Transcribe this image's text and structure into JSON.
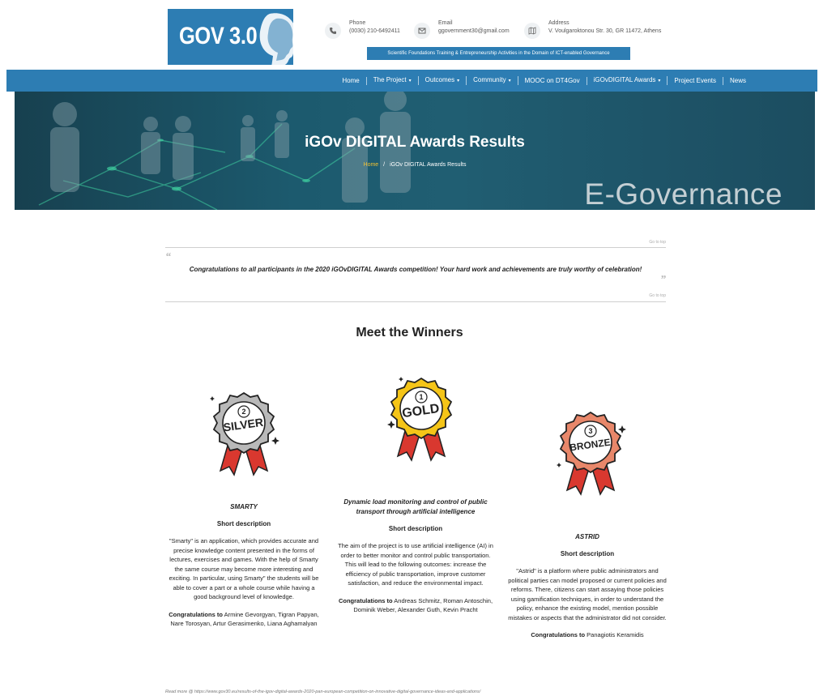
{
  "header": {
    "logo_text": "GOV 3.0",
    "phone_label": "Phone",
    "phone_value": "(0030) 210-6492411",
    "email_label": "Email",
    "email_value": "ggovernment30@gmail.com",
    "address_label": "Address",
    "address_value": "V. Voulgaroktonou Str. 30, GR 11472, Athens",
    "tagline": "Scientific Foundations Training & Entrepreneurship Activities in the Domain of ICT-enabled Governance"
  },
  "nav": {
    "items": [
      {
        "label": "Home",
        "caret": ""
      },
      {
        "label": "The Project",
        "caret": "▾"
      },
      {
        "label": "Outcomes",
        "caret": "▾"
      },
      {
        "label": "Community",
        "caret": "▾"
      },
      {
        "label": "MOOC on DT4Gov",
        "caret": ""
      },
      {
        "label": "iGOvDIGITAL Awards",
        "caret": "▾"
      },
      {
        "label": "Project Events",
        "caret": ""
      },
      {
        "label": "News",
        "caret": ""
      }
    ]
  },
  "hero": {
    "title": "iGOv DIGITAL Awards Results",
    "crumb_home": "Home",
    "crumb_sep": "/",
    "crumb_current": "iGOv DIGITAL Awards Results",
    "watermark": "E-Governance"
  },
  "quote": {
    "goto_top": "Go to top",
    "goto_bottom": "Go to top",
    "open_mark": "“",
    "close_mark": "”",
    "text": "Congratulations to all participants in the 2020 iGOvDIGITAL Awards competition! Your hard work and achievements are truly worthy of celebration!"
  },
  "section_title": "Meet the Winners",
  "winners": {
    "silver": {
      "medal_number": "2",
      "medal_word": "SILVER",
      "name": "SMARTY",
      "sub": "Short description",
      "desc": "\"Smarty\" is an application, which provides accurate and precise knowledge content presented in the forms of lectures, exercises and games. With the help of Smarty the same course may become more interesting and exciting. In particular, using Smarty\" the students will be able to cover a part or a whole course while having a good background level of knowledge.",
      "congrats_prefix": "Congratulations to",
      "congrats_names": "Armine Gevorgyan, Tigran Papyan, Nare Torosyan, Artur Gerasimenko, Liana Aghamalyan"
    },
    "gold": {
      "medal_number": "1",
      "medal_word": "GOLD",
      "name": "Dynamic load monitoring and control of public transport through artificial intelligence",
      "sub": "Short description",
      "desc": "The aim of the project is to use artificial intelligence (AI) in order to better monitor and control public transportation. This will lead to the following outcomes: increase the efficiency of public transportation, improve customer satisfaction, and reduce the environmental impact.",
      "congrats_prefix": "Congratulations to",
      "congrats_names": "Andreas Schmitz, Roman Antoschin, Dominik Weber, Alexander Guth, Kevin Pracht"
    },
    "bronze": {
      "medal_number": "3",
      "medal_word": "BRONZE",
      "name": "ASTRID",
      "sub": "Short description",
      "desc": "\"Astrid\" is a platform where public administrators and political parties can model proposed or current policies and reforms. There, citizens can start assaying those policies using gamification techniques, in order to understand the policy, enhance the existing model, mention possible mistakes or aspects that the administrator did not consider.",
      "congrats_prefix": "Congratulations to",
      "congrats_names": "Panagiotis Keramidis"
    }
  },
  "read_more": "Read more @ https://www.gov30.eu/results-of-the-igov-digital-awards-2020-pan-european-competition-on-innovative-digital-governance-ideas-and-applications/",
  "colors": {
    "primary": "#2d7db3",
    "crumb_home": "#f3c233",
    "medal_red": "#d9382f",
    "gold": "#f5c518",
    "silver": "#b9b9b9",
    "bronze": "#e8876a"
  }
}
